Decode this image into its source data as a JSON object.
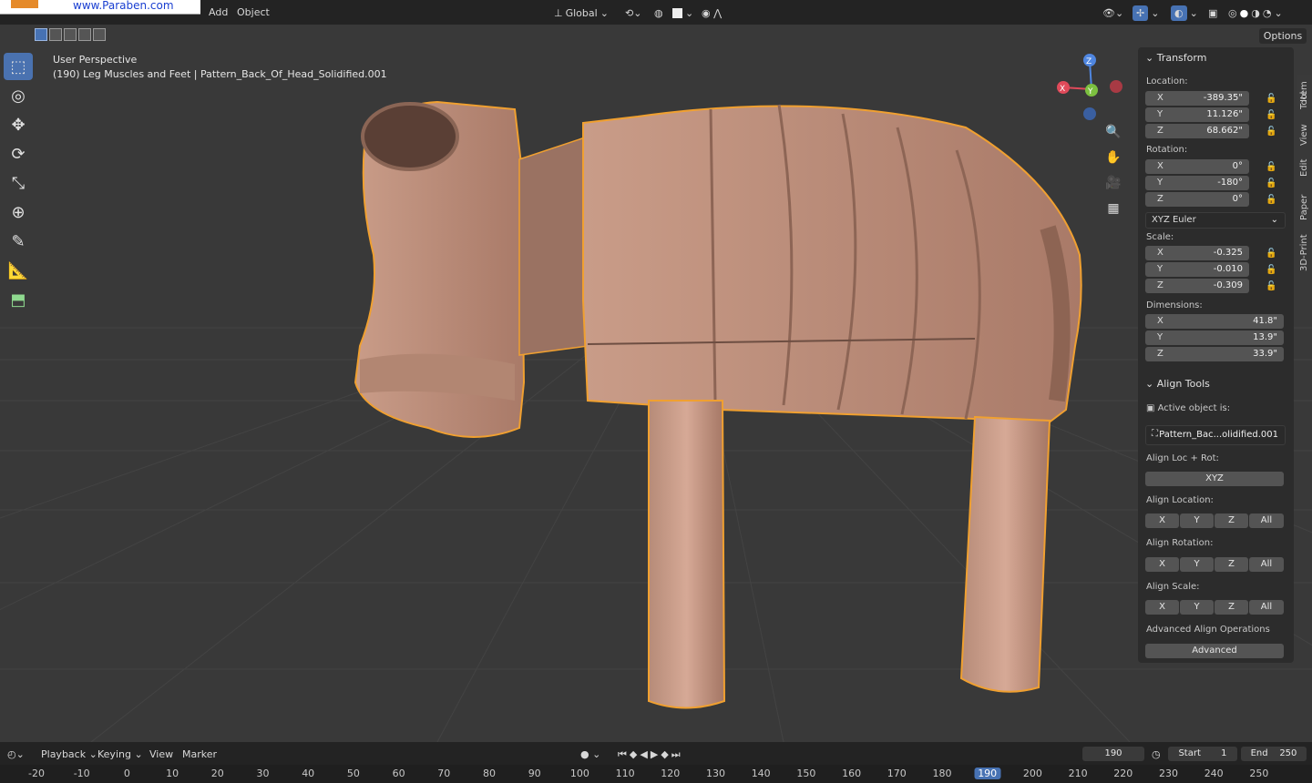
{
  "watermark": {
    "text": "www.Paraben.com"
  },
  "menu": {
    "add": "Add",
    "object": "Object"
  },
  "header": {
    "transform_orientation": "Global",
    "options": "Options"
  },
  "viewport": {
    "perspective": "User Perspective",
    "object_info": "(190) Leg Muscles and Feet | Pattern_Back_Of_Head_Solidified.001"
  },
  "gizmo": {
    "z": "Z",
    "x": "X",
    "y": "Y"
  },
  "transform": {
    "title": "Transform",
    "location_label": "Location:",
    "location": [
      {
        "axis": "X",
        "value": "-389.35\""
      },
      {
        "axis": "Y",
        "value": "11.126\""
      },
      {
        "axis": "Z",
        "value": "68.662\""
      }
    ],
    "rotation_label": "Rotation:",
    "rotation": [
      {
        "axis": "X",
        "value": "0°"
      },
      {
        "axis": "Y",
        "value": "-180°"
      },
      {
        "axis": "Z",
        "value": "0°"
      }
    ],
    "rotation_mode": "XYZ Euler",
    "scale_label": "Scale:",
    "scale": [
      {
        "axis": "X",
        "value": "-0.325"
      },
      {
        "axis": "Y",
        "value": "-0.010"
      },
      {
        "axis": "Z",
        "value": "-0.309"
      }
    ],
    "dimensions_label": "Dimensions:",
    "dimensions": [
      {
        "axis": "X",
        "value": "41.8\""
      },
      {
        "axis": "Y",
        "value": "13.9\""
      },
      {
        "axis": "Z",
        "value": "33.9\""
      }
    ]
  },
  "align_tools": {
    "title": "Align Tools",
    "active_label": "Active object is:",
    "active_object": "Pattern_Bac...olidified.001",
    "loc_rot_label": "Align Loc + Rot:",
    "loc_rot_btn": "XYZ",
    "location_label": "Align Location:",
    "rotation_label": "Align Rotation:",
    "scale_label": "Align Scale:",
    "axis_buttons": [
      "X",
      "Y",
      "Z",
      "All"
    ],
    "advanced_label": "Advanced Align Operations",
    "advanced_btn": "Advanced"
  },
  "side_tabs": [
    "Item",
    "Tool",
    "View",
    "Edit",
    "Paper",
    "3D-Print"
  ],
  "timeline": {
    "playback": "Playback",
    "keying": "Keying",
    "view": "View",
    "marker": "Marker",
    "current_frame": "190",
    "start_label": "Start",
    "start": "1",
    "end_label": "End",
    "end": "250"
  },
  "ruler": [
    "-20",
    "-10",
    "0",
    "10",
    "20",
    "30",
    "40",
    "50",
    "60",
    "70",
    "80",
    "90",
    "100",
    "110",
    "120",
    "130",
    "140",
    "150",
    "160",
    "170",
    "180",
    "190",
    "200",
    "210",
    "220",
    "230",
    "240",
    "250"
  ],
  "ruler_current": "190",
  "colors": {
    "selection_outline": "#f0a030",
    "model": "#c99a86",
    "accent": "#4772b3"
  }
}
